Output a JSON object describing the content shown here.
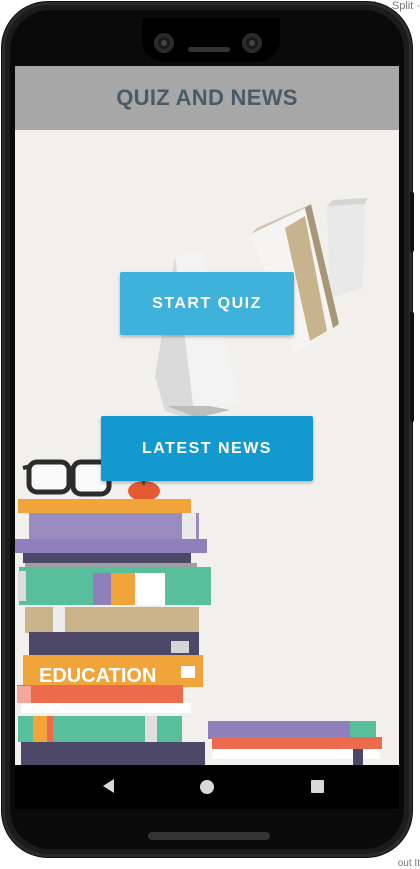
{
  "app": {
    "title": "QUIZ AND NEWS"
  },
  "buttons": {
    "start_quiz": "START QUIZ",
    "latest_news": "LATEST NEWS"
  },
  "illustration": {
    "book_label": "EDUCATION"
  },
  "edge_fragments": {
    "top": "Code · Split ·",
    "bottom": "out It"
  },
  "colors": {
    "toolbar": "#a7a7a7",
    "title_text": "#4b5b66",
    "start_quiz_button": "#3fb2dc",
    "latest_news_button": "#129ad0",
    "screen_background": "#f2f0ed"
  },
  "navigation": {
    "icons": [
      "back-icon",
      "home-icon",
      "recents-icon"
    ]
  }
}
